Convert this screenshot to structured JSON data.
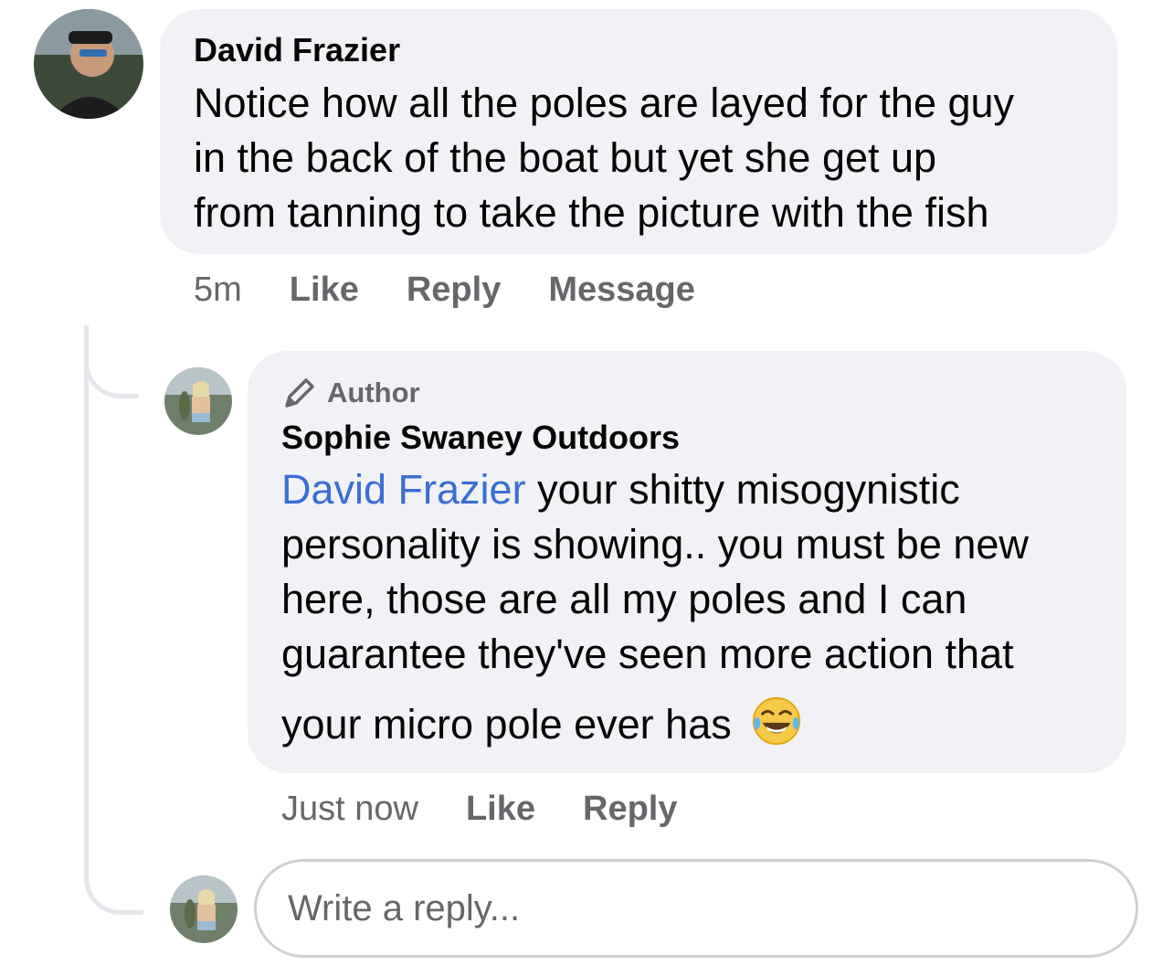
{
  "comment": {
    "author": "David Frazier",
    "text_lines": [
      "Notice how all the poles are layed for the guy",
      "in the back of the boat but yet she get up",
      "from tanning to take the picture with the fish"
    ],
    "time": "5m",
    "like_label": "Like",
    "reply_label": "Reply",
    "message_label": "Message"
  },
  "reply": {
    "badge": "Author",
    "author": "Sophie Swaney Outdoors",
    "mention": "David Frazier",
    "text_first": " your shitty misogynistic",
    "text_lines": [
      "personality is showing.. you must be new",
      "here, those are all my poles and I can",
      "guarantee they've seen more action that",
      "your micro pole ever has"
    ],
    "emoji": "face-with-tears-of-joy",
    "time": "Just now",
    "like_label": "Like",
    "reply_label": "Reply"
  },
  "composer": {
    "placeholder": "Write a reply..."
  },
  "colors": {
    "mention": "#3a6fd1",
    "bubble": "#f0f2f5",
    "meta": "#65676b"
  }
}
